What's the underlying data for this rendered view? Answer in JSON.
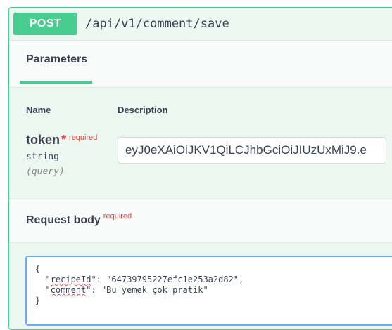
{
  "operation": {
    "method": "POST",
    "path": "/api/v1/comment/save",
    "accent_color": "#49cc90"
  },
  "parameters": {
    "tab_label": "Parameters",
    "columns": {
      "name": "Name",
      "description": "Description"
    },
    "items": [
      {
        "name": "token",
        "required_mark": "*",
        "required_label": "required",
        "type": "string",
        "in": "(query)",
        "value": "eyJ0eXAiOiJKV1QiLCJhbGciOiJIUzUxMiJ9.e"
      }
    ]
  },
  "request_body": {
    "title": "Request body",
    "required_label": "required",
    "lines": {
      "open": "{",
      "recipe_key": "recipeId",
      "recipe_value": "\"64739795227efc1e253a2d82\",",
      "comment_key": "comment",
      "comment_value": "\"Bu yemek çok pratik\"",
      "close": "}"
    },
    "editor_border_color": "#61affe"
  }
}
